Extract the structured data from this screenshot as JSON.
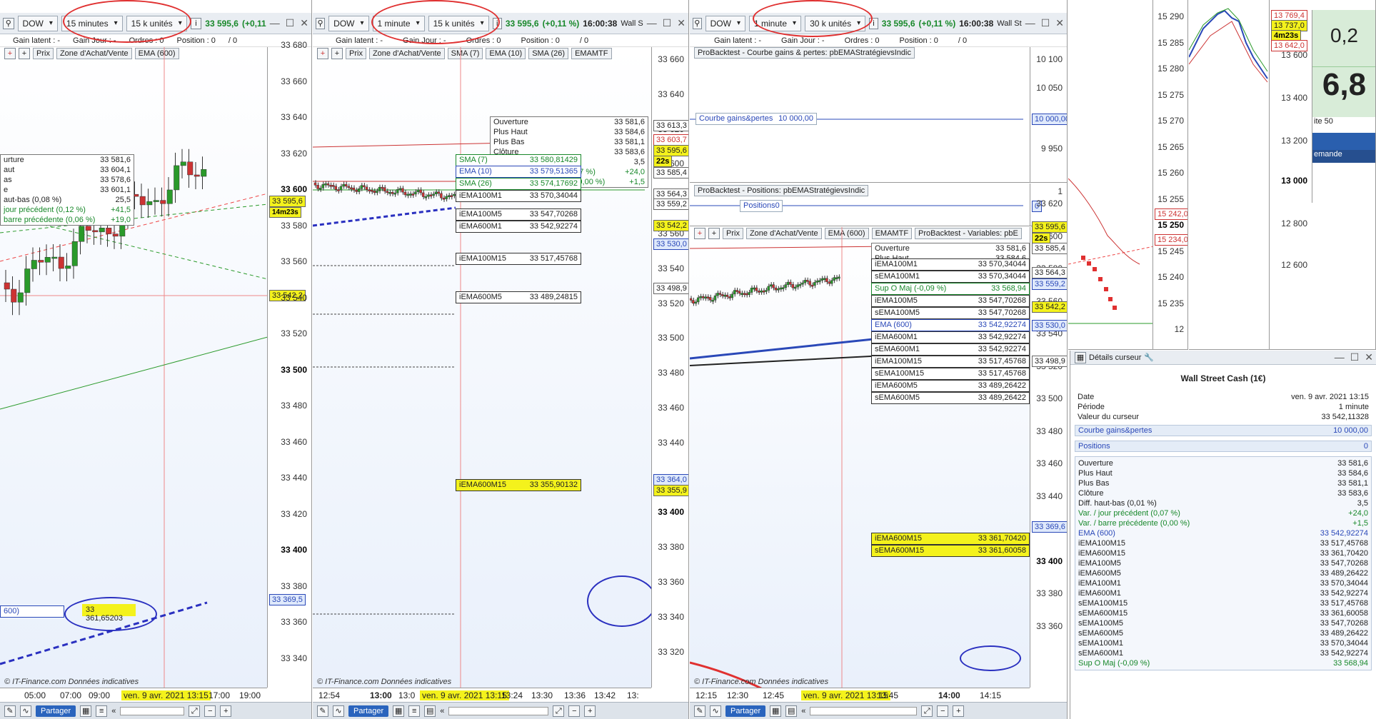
{
  "windows": [
    {
      "instrument": "DOW",
      "interval": "15 minutes",
      "units": "15 k unités",
      "price": "33 595,6",
      "change": "(+0,11",
      "time": "",
      "status": {
        "gain_latent": "Gain latent : -",
        "gain_jour": "Gain Jour : -",
        "ordres": "Ordres : 0",
        "position": "Position : 0",
        "slash": "/ 0"
      },
      "legend": [
        "Prix",
        "Zone d'Achat/Vente",
        "EMA (600)"
      ],
      "yticks": [
        "33 680",
        "33 660",
        "33 640",
        "33 620",
        "33 600",
        "33 580",
        "33 560",
        "33 540",
        "33 520",
        "33 500",
        "33 480",
        "33 460",
        "33 440",
        "33 420",
        "33 400",
        "33 380",
        "33 360",
        "33 340"
      ],
      "xticks": [
        "05:00",
        "07:00",
        "09:00",
        "ven. 9 avr. 2021 13:15",
        "17:00",
        "19:00"
      ],
      "ylabels": {
        "price": "33 595,6",
        "timer": "14m23s",
        "low": "33 542,2",
        "ema": "33 369,5"
      },
      "info": [
        [
          "urture",
          "33 581,6"
        ],
        [
          "aut",
          "33 604,1"
        ],
        [
          "as",
          "33 578,6"
        ],
        [
          "e",
          "33 601,1"
        ],
        [
          "aut-bas (0,08 %)",
          "25,5"
        ],
        [
          "jour précédent (0,12 %)",
          "+41,5"
        ],
        [
          "barre précédente (0,06 %)",
          "+19,0"
        ]
      ],
      "callout_left": "600)",
      "callout_value": "33 361,65203"
    },
    {
      "instrument": "DOW",
      "interval": "1 minute",
      "units": "15 k unités",
      "price": "33 595,6",
      "change": "(+0,11 %)",
      "time": "16:00:38",
      "wall": "Wall S",
      "status": {
        "gain_latent": "Gain latent : -",
        "gain_jour": "Gain Jour : -",
        "ordres": "Ordres : 0",
        "position": "Position : 0",
        "slash": "/ 0"
      },
      "legend": [
        "Prix",
        "Zone d'Achat/Vente",
        "SMA (7)",
        "EMA (10)",
        "SMA (26)",
        "EMAMTF"
      ],
      "yticks": [
        "33 660",
        "33 640",
        "33 620",
        "33 600",
        "33 580",
        "33 560",
        "33 540",
        "33 520",
        "33 500",
        "33 480",
        "33 460",
        "33 440",
        "33 420",
        "33 400",
        "33 380",
        "33 360",
        "33 340",
        "33 320"
      ],
      "xticks": [
        "12:54",
        "13:00",
        "13:0",
        "ven. 9 avr. 2021 13:15",
        "13:24",
        "13:30",
        "13:36",
        "13:42",
        "13:"
      ],
      "ylabels": [
        "33 613,3",
        "33 603,7",
        "33 595,6",
        "22s",
        "33 585,4",
        "33 564,3",
        "33 559,2",
        "33 542,2",
        "33 530,0",
        "33 498,9",
        "33 364,0",
        "33 355,9"
      ],
      "info": [
        [
          "Ouverture",
          "33 581,6"
        ],
        [
          "Plus Haut",
          "33 584,6"
        ],
        [
          "Plus Bas",
          "33 581,1"
        ],
        [
          "Clôture",
          "33 583,6"
        ],
        [
          "Diff. haut-bas (0,01 %)",
          "3,5"
        ],
        [
          "Var. / jour précédent (0,07 %)",
          "+24,0"
        ],
        [
          "Var. / barre précédente (0,00 %)",
          "+1,5"
        ]
      ],
      "boxes": [
        [
          "SMA (7)",
          "33 580,81429"
        ],
        [
          "EMA (10)",
          "33 579,51365"
        ],
        [
          "SMA (26)",
          "33 574,17692"
        ],
        [
          "iEMA100M1",
          "33 570,34044"
        ],
        [
          "iEMA100M5",
          "33 547,70268"
        ],
        [
          "iEMA600M1",
          "33 542,92274"
        ],
        [
          "iEMA100M15",
          "33 517,45768"
        ],
        [
          "iEMA600M5",
          "33 489,24815"
        ],
        [
          "iEMA600M15",
          "33 355,90132"
        ]
      ]
    },
    {
      "instrument": "DOW",
      "interval": "1 minute",
      "units": "30 k unités",
      "price": "33 595,6",
      "change": "(+0,11 %)",
      "time": "16:00:38",
      "wall": "Wall St",
      "status": {
        "gain_latent": "Gain latent : -",
        "gain_jour": "Gain Jour : -",
        "ordres": "Ordres : 0",
        "position": "Position : 0",
        "slash": "/ 0"
      },
      "panel1": {
        "title": "ProBacktest - Courbe gains & pertes: pbEMAStratégievsIndic",
        "label": "Courbe gains&pertes",
        "value": "10 000,00",
        "ticks": [
          "10 100",
          "10 050",
          "10 000",
          "9 950"
        ]
      },
      "panel2": {
        "title": "ProBacktest - Positions: pbEMAStratégievsIndic",
        "label": "Positions",
        "value": "0",
        "ticks": [
          "1",
          "0"
        ]
      },
      "legend": [
        "Prix",
        "Zone d'Achat/Vente",
        "EMA (600)",
        "EMAMTF",
        "ProBacktest - Variables: pbE"
      ],
      "yticks": [
        "33 620",
        "33 600",
        "33 580",
        "33 560",
        "33 540",
        "33 520",
        "33 500",
        "33 480",
        "33 460",
        "33 440",
        "33 420",
        "33 400",
        "33 380",
        "33 360"
      ],
      "xticks": [
        "12:15",
        "12:30",
        "12:45",
        "ven. 9 avr. 2021 13:15",
        "13:45",
        "14:00",
        "14:15"
      ],
      "ylabels": [
        "33 595,6",
        "22s",
        "33 585,4",
        "33 564,3",
        "33 559,2",
        "33 542,2",
        "33 530,0",
        "33 498,9",
        "33 369,6"
      ],
      "info": [
        [
          "Ouverture",
          "33 581,6"
        ],
        [
          "Plus Haut",
          "33 584,6"
        ],
        [
          "Plus Bas",
          "33 581,1"
        ],
        [
          "Clôture",
          "33 583,6"
        ],
        [
          "Diff. haut-bas (0,01 %)",
          "3,5"
        ],
        [
          "Var. / jour précédent (0,07 %)",
          "+24,0"
        ],
        [
          "Var. / barre précédente (0,00 %)",
          "+1,5"
        ]
      ],
      "boxes": [
        [
          "iEMA100M1",
          "33 570,34044"
        ],
        [
          "sEMA100M1",
          "33 570,34044"
        ],
        [
          "Sup O Maj (-0,09 %)",
          "33 568,94"
        ],
        [
          "iEMA100M5",
          "33 547,70268"
        ],
        [
          "sEMA100M5",
          "33 547,70268"
        ],
        [
          "EMA (600)",
          "33 542,92274"
        ],
        [
          "iEMA600M1",
          "33 542,92274"
        ],
        [
          "sEMA600M1",
          "33 542,92274"
        ],
        [
          "iEMA100M15",
          "33 517,45768"
        ],
        [
          "sEMA100M15",
          "33 517,45768"
        ],
        [
          "iEMA600M5",
          "33 489,26422"
        ],
        [
          "sEMA600M5",
          "33 489,26422"
        ],
        [
          "iEMA600M15",
          "33 361,70420"
        ],
        [
          "sEMA600M15",
          "33 361,60058"
        ]
      ]
    }
  ],
  "side": {
    "yticks1": [
      "15 290",
      "15 285",
      "15 280",
      "15 275",
      "15 270",
      "15 265",
      "15 260",
      "15 255",
      "15 250",
      "15 245",
      "15 240",
      "15 235",
      "12"
    ],
    "labels1": [
      "15 242,0",
      "15 234,0"
    ],
    "yticks2": [
      "13 769,4",
      "13 737,0",
      "4m23s",
      "13 642,0",
      "13 600",
      "13 400",
      "13 200",
      "13 000",
      "12 800",
      "12 600"
    ],
    "big1": "0,2",
    "big2": "6,8",
    "small": "ite 50",
    "demande": "emande"
  },
  "details": {
    "title": "Détails curseur",
    "instrument": "Wall Street Cash (1€)",
    "meta": [
      [
        "Date",
        "ven. 9 avr. 2021 13:15"
      ],
      [
        "Période",
        "1 minute"
      ],
      [
        "Valeur du curseur",
        "33 542,11328"
      ]
    ],
    "sec1": [
      [
        "Courbe gains&pertes",
        "10 000,00"
      ]
    ],
    "sec2": [
      [
        "Positions",
        "0"
      ]
    ],
    "ohlc": [
      [
        "Ouverture",
        "33 581,6"
      ],
      [
        "Plus Haut",
        "33 584,6"
      ],
      [
        "Plus Bas",
        "33 581,1"
      ],
      [
        "Clôture",
        "33 583,6"
      ],
      [
        "Diff. haut-bas (0,01 %)",
        "3,5"
      ],
      [
        "Var. / jour précédent (0,07 %)",
        "+24,0"
      ],
      [
        "Var. / barre précédente (0,00 %)",
        "+1,5"
      ],
      [
        "EMA (600)",
        "33 542,92274"
      ],
      [
        "iEMA100M15",
        "33 517,45768"
      ],
      [
        "iEMA600M15",
        "33 361,70420"
      ],
      [
        "iEMA100M5",
        "33 547,70268"
      ],
      [
        "iEMA600M5",
        "33 489,26422"
      ],
      [
        "iEMA100M1",
        "33 570,34044"
      ],
      [
        "iEMA600M1",
        "33 542,92274"
      ],
      [
        "sEMA100M15",
        "33 517,45768"
      ],
      [
        "sEMA600M15",
        "33 361,60058"
      ],
      [
        "sEMA100M5",
        "33 547,70268"
      ],
      [
        "sEMA600M5",
        "33 489,26422"
      ],
      [
        "sEMA100M1",
        "33 570,34044"
      ],
      [
        "sEMA600M1",
        "33 542,92274"
      ],
      [
        "Sup O Maj (-0,09 %)",
        "33 568,94"
      ]
    ]
  },
  "common": {
    "source": "© IT-Finance.com",
    "source_it": "Données indicatives",
    "share": "Partager",
    "cursor_date": "ven. 9 avr. 2021 13:15"
  }
}
